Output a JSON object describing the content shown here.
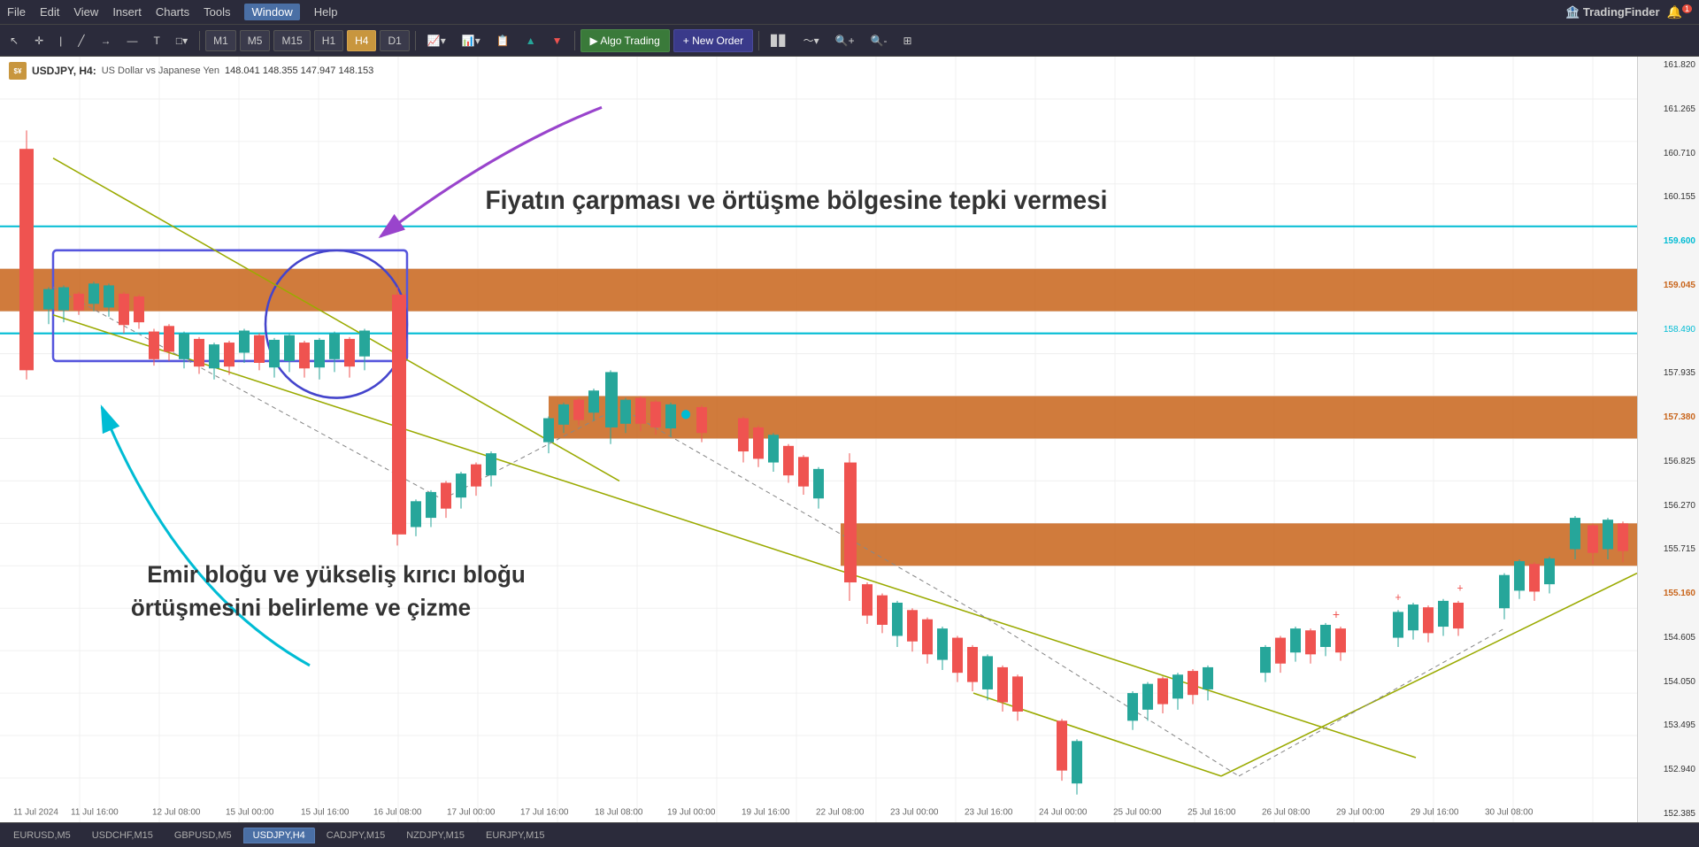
{
  "menubar": {
    "items": [
      "File",
      "Edit",
      "View",
      "Insert",
      "Charts",
      "Tools",
      "Window",
      "Help"
    ],
    "active": "Window"
  },
  "toolbar": {
    "timeframes": [
      "M1",
      "M5",
      "M15",
      "H1",
      "H4",
      "D1"
    ],
    "active_tf": "H4",
    "algo_label": "Algo Trading",
    "order_label": "New Order"
  },
  "chart": {
    "symbol": "USDJPY",
    "timeframe": "H4",
    "description": "US Dollar vs Japanese Yen",
    "prices": "148.041  148.355  147.947  148.153",
    "annotation1": "Fiyatın çarpması ve örtüşme bölgesine tepki vermesi",
    "annotation2": "Emir bloğu ve yükseliş kırıcı bloğu\nörtüşmesini belirleme ve çizme",
    "price_levels": [
      "161.820",
      "161.265",
      "160.710",
      "160.155",
      "159.600",
      "159.045",
      "158.490",
      "157.935",
      "157.380",
      "156.825",
      "156.270",
      "155.715",
      "155.160",
      "154.605",
      "154.050",
      "153.495",
      "152.940",
      "152.385"
    ]
  },
  "time_labels": [
    "11 Jul 2024",
    "11 Jul 16:00",
    "12 Jul 08:00",
    "15 Jul 00:00",
    "15 Jul 16:00",
    "16 Jul 08:00",
    "17 Jul 00:00",
    "17 Jul 16:00",
    "18 Jul 08:00",
    "19 Jul 00:00",
    "19 Jul 16:00",
    "22 Jul 08:00",
    "23 Jul 00:00",
    "23 Jul 16:00",
    "24 Jul 00:00",
    "25 Jul 00:00",
    "25 Jul 16:00",
    "26 Jul 08:00",
    "29 Jul 00:00",
    "29 Jul 16:00",
    "30 Jul 08:00"
  ],
  "bottom_tabs": [
    "EURUSD,M5",
    "USDCHF,M15",
    "GBPUSD,M5",
    "USDJPY,H4",
    "CADJPY,M15",
    "NZDJPY,M15",
    "EURJPY,M15"
  ],
  "active_tab": "USDJPY,H4",
  "logo": "TradingFinder"
}
